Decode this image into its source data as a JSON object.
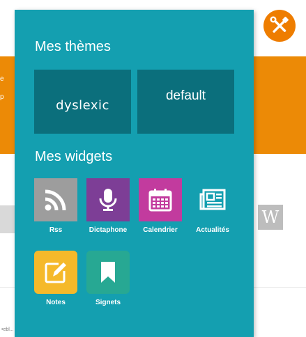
{
  "background": {
    "edge_text_1": "e",
    "edge_text_2": "p",
    "wiki_button": "W",
    "footer_text": "•ebl... ...",
    "tools_icon": "tools-icon"
  },
  "panel": {
    "themes_title": "Mes thèmes",
    "themes": [
      {
        "label": "dyslexic"
      },
      {
        "label": "default"
      }
    ],
    "widgets_title": "Mes widgets",
    "widgets": [
      {
        "label": "Rss",
        "icon": "rss-icon",
        "color": "#9d9d9d"
      },
      {
        "label": "Dictaphone",
        "icon": "microphone-icon",
        "color": "#7d3e96"
      },
      {
        "label": "Calendrier",
        "icon": "calendar-icon",
        "color": "#c23b9e"
      },
      {
        "label": "Actualités",
        "icon": "newspaper-icon",
        "color": "#149fb0"
      },
      {
        "label": "Notes",
        "icon": "pencil-note-icon",
        "color": "#f5b92a"
      },
      {
        "label": "Signets",
        "icon": "bookmark-icon",
        "color": "#27a893"
      }
    ]
  },
  "colors": {
    "panel": "#149fb0",
    "theme_button": "#0b6f7c",
    "accent_orange": "#ec8a06"
  }
}
